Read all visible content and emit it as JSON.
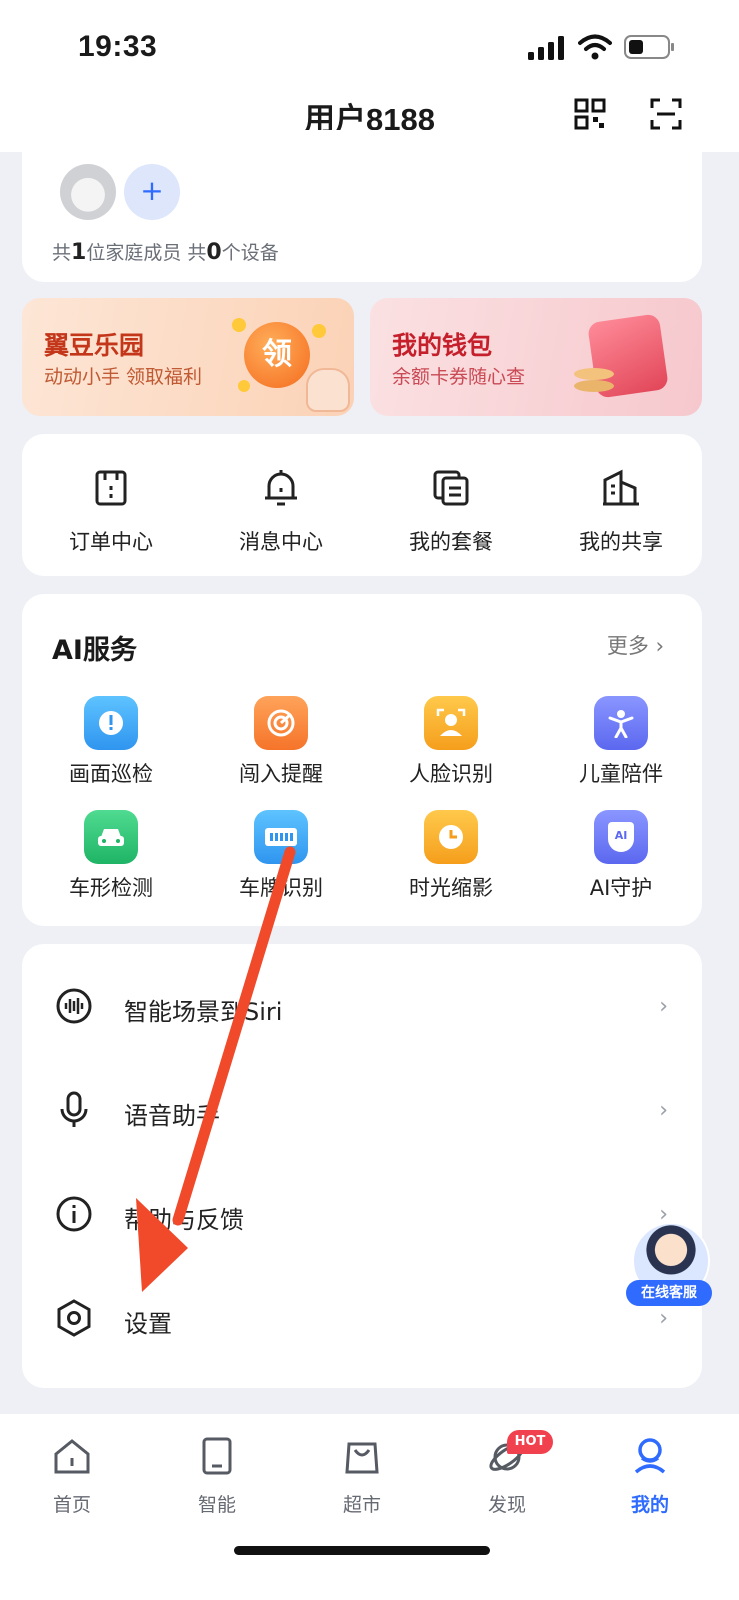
{
  "status_bar": {
    "time": "19:33"
  },
  "header": {
    "title": "用户8188"
  },
  "family": {
    "prefix1": "共",
    "members": "1",
    "mid": "位家庭成员 共",
    "devices": "0",
    "suffix": "个设备",
    "add_symbol": "+"
  },
  "promos": [
    {
      "title": "翼豆乐园",
      "subtitle": "动动小手 领取福利",
      "badge": "领"
    },
    {
      "title": "我的钱包",
      "subtitle": "余额卡券随心查"
    }
  ],
  "quick": [
    {
      "label": "订单中心",
      "icon": "order-icon"
    },
    {
      "label": "消息中心",
      "icon": "bell-icon"
    },
    {
      "label": "我的套餐",
      "icon": "package-icon"
    },
    {
      "label": "我的共享",
      "icon": "share-icon"
    }
  ],
  "ai": {
    "title": "AI服务",
    "more": "更多",
    "items": [
      {
        "label": "画面巡检",
        "icon": "alert-icon",
        "color": "#3aaaf5"
      },
      {
        "label": "闯入提醒",
        "icon": "intrusion-icon",
        "color": "#fb8a3c"
      },
      {
        "label": "人脸识别",
        "icon": "face-icon",
        "color": "#f7b22e"
      },
      {
        "label": "儿童陪伴",
        "icon": "child-icon",
        "color": "#6f7cf5"
      },
      {
        "label": "车形检测",
        "icon": "car-icon",
        "color": "#2fc47a"
      },
      {
        "label": "车牌识别",
        "icon": "plate-icon",
        "color": "#3aaaf5"
      },
      {
        "label": "时光缩影",
        "icon": "clock-icon",
        "color": "#f7b22e"
      },
      {
        "label": "AI守护",
        "icon": "ai-shield-icon",
        "color": "#6f7cf5",
        "badge": "AI"
      }
    ]
  },
  "settings_list": [
    {
      "label": "智能场景到Siri",
      "icon": "siri-icon"
    },
    {
      "label": "语音助手",
      "icon": "mic-icon"
    },
    {
      "label": "帮助与反馈",
      "icon": "info-icon"
    },
    {
      "label": "设置",
      "icon": "settings-icon"
    }
  ],
  "support": {
    "label": "在线客服"
  },
  "tabs": [
    {
      "label": "首页",
      "icon": "home-icon"
    },
    {
      "label": "智能",
      "icon": "tablet-icon"
    },
    {
      "label": "超市",
      "icon": "bag-icon"
    },
    {
      "label": "发现",
      "icon": "planet-icon",
      "badge": "HOT"
    },
    {
      "label": "我的",
      "icon": "profile-icon",
      "active": true
    }
  ],
  "colors": {
    "accent": "#2f6bff",
    "arrow": "#f04a2b",
    "hot": "#f2414e"
  }
}
